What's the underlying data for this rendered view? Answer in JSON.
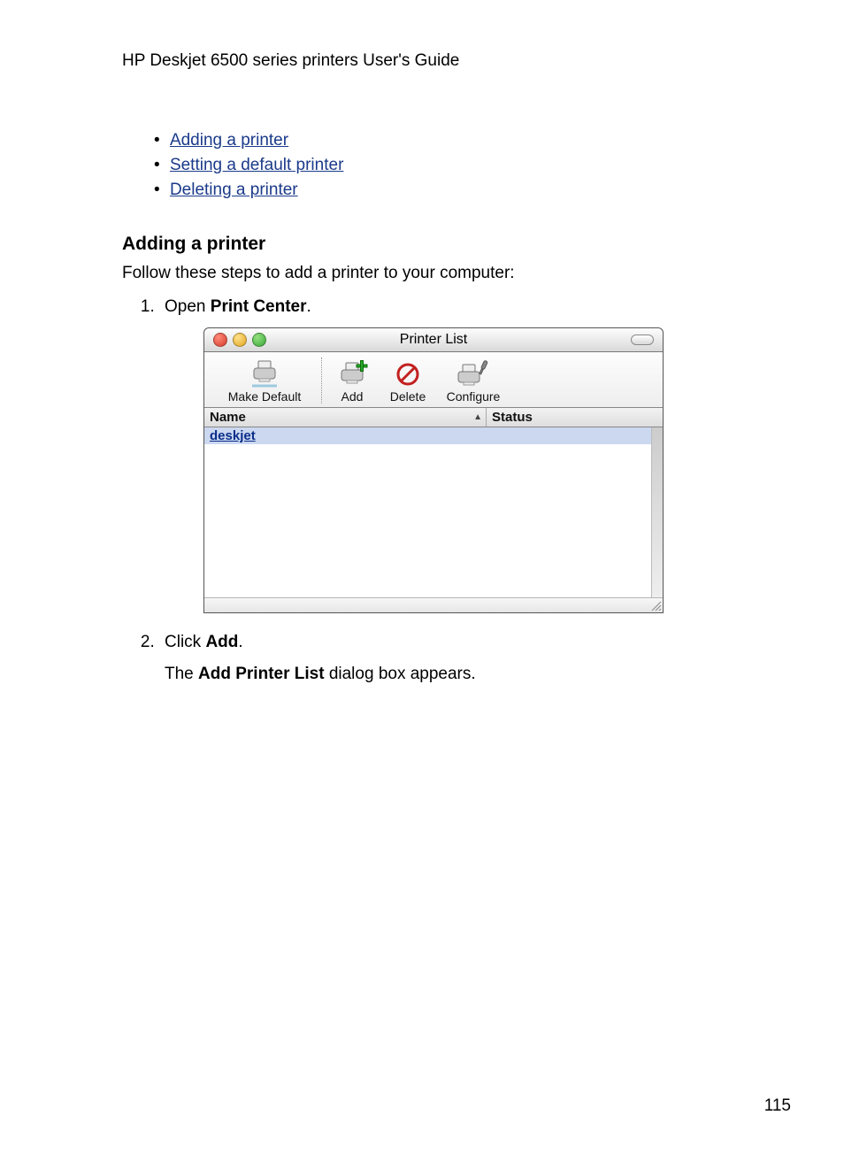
{
  "doc": {
    "header": "HP Deskjet 6500 series printers User's Guide",
    "page_number": "115"
  },
  "toc": {
    "items": [
      {
        "label": "Adding a printer"
      },
      {
        "label": "Setting a default printer"
      },
      {
        "label": "Deleting a printer"
      }
    ]
  },
  "section": {
    "heading": "Adding a printer",
    "lead": "Follow these steps to add a printer to your computer:",
    "steps": {
      "s1_pre": "Open ",
      "s1_bold": "Print Center",
      "s1_post": ".",
      "s2_pre": "Click ",
      "s2_bold": "Add",
      "s2_post": ".",
      "s2_sub_pre": "The ",
      "s2_sub_bold": "Add Printer List",
      "s2_sub_post": " dialog box appears."
    }
  },
  "window": {
    "title": "Printer List",
    "toolbar": {
      "make_default": "Make Default",
      "add": "Add",
      "delete": "Delete",
      "configure": "Configure"
    },
    "columns": {
      "name": "Name",
      "status": "Status"
    },
    "rows": [
      {
        "name": "deskjet",
        "status": ""
      }
    ]
  }
}
